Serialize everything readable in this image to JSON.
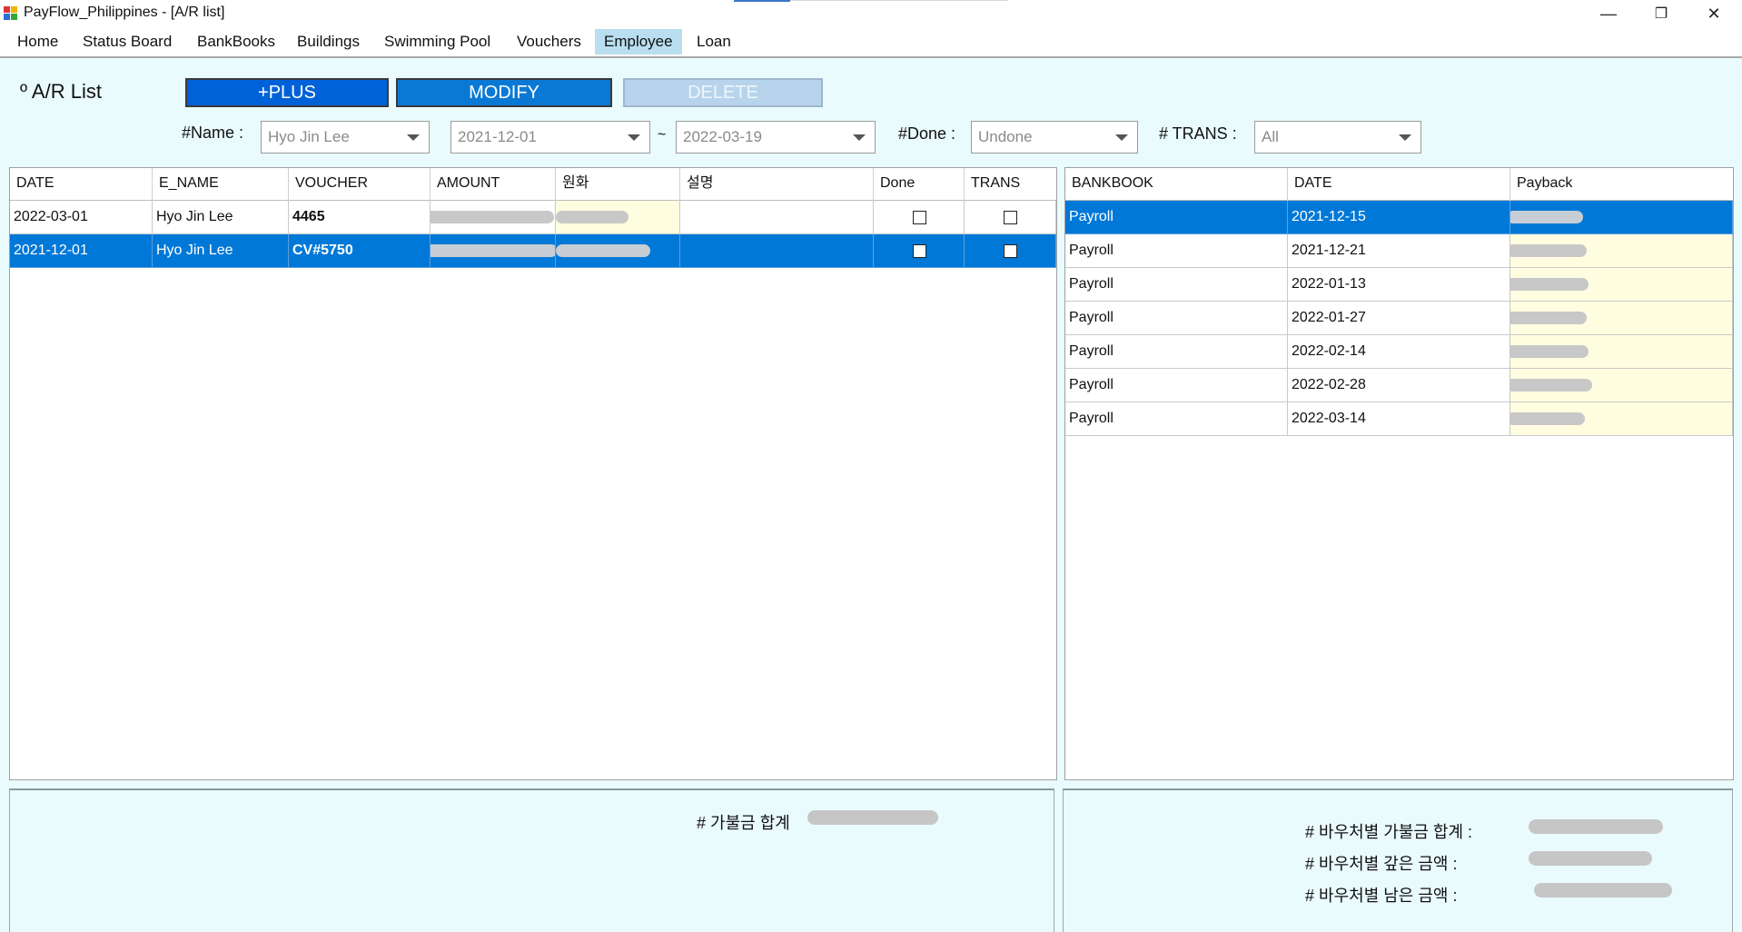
{
  "window": {
    "title": "PayFlow_Philippines - [A/R list]",
    "controls": {
      "minimize": "—",
      "restore": "❐",
      "close": "✕"
    }
  },
  "menu": [
    "Home",
    "Status Board",
    "BankBooks",
    "Buildings",
    "Swimming Pool",
    "Vouchers",
    "Employee",
    "Loan"
  ],
  "menu_active": "Employee",
  "page": {
    "title": "º A/R List",
    "buttons": {
      "plus": "+PLUS",
      "modify": "MODIFY",
      "delete": "DELETE"
    },
    "filters": {
      "name_label": "#Name :",
      "name_value": "Hyo Jin Lee",
      "date_from": "2021-12-01",
      "tilde": "~",
      "date_to": "2022-03-19",
      "done_label": "#Done :",
      "done_value": "Undone",
      "trans_label": "# TRANS :",
      "trans_value": "All"
    }
  },
  "ar_table": {
    "columns": [
      "DATE",
      "E_NAME",
      "VOUCHER",
      "AMOUNT",
      "원화",
      "설명",
      "Done",
      "TRANS"
    ],
    "rows": [
      {
        "date": "2022-03-01",
        "name": "Hyo Jin Lee",
        "voucher": "4465",
        "description": "",
        "done": false,
        "trans": false,
        "selected": false
      },
      {
        "date": "2021-12-01",
        "name": "Hyo Jin Lee",
        "voucher": "CV#5750",
        "description": "",
        "done": false,
        "trans": false,
        "selected": true
      }
    ]
  },
  "payback_table": {
    "columns": [
      "BANKBOOK",
      "DATE",
      "Payback"
    ],
    "rows": [
      {
        "bankbook": "Payroll",
        "date": "2021-12-15",
        "selected": true
      },
      {
        "bankbook": "Payroll",
        "date": "2021-12-21",
        "selected": false
      },
      {
        "bankbook": "Payroll",
        "date": "2022-01-13",
        "selected": false
      },
      {
        "bankbook": "Payroll",
        "date": "2022-01-27",
        "selected": false
      },
      {
        "bankbook": "Payroll",
        "date": "2022-02-14",
        "selected": false
      },
      {
        "bankbook": "Payroll",
        "date": "2022-02-28",
        "selected": false
      },
      {
        "bankbook": "Payroll",
        "date": "2022-03-14",
        "selected": false
      }
    ]
  },
  "summary_left": {
    "label": "# 가불금 합계"
  },
  "summary_right": {
    "total_label": "# 바우처별 가불금 합계 :",
    "paid_label": "# 바우처별 갚은 금액 :",
    "remain_label": "# 바우처별 남은 금액 :"
  },
  "colors": {
    "selection": "#0078d7",
    "panel_bg": "#eafbfd",
    "plus": "#0062d8",
    "modify": "#0a79d6",
    "delete": "#b8d4ec",
    "yellow_cell": "#fffde0",
    "active_menu": "#b8def0"
  }
}
